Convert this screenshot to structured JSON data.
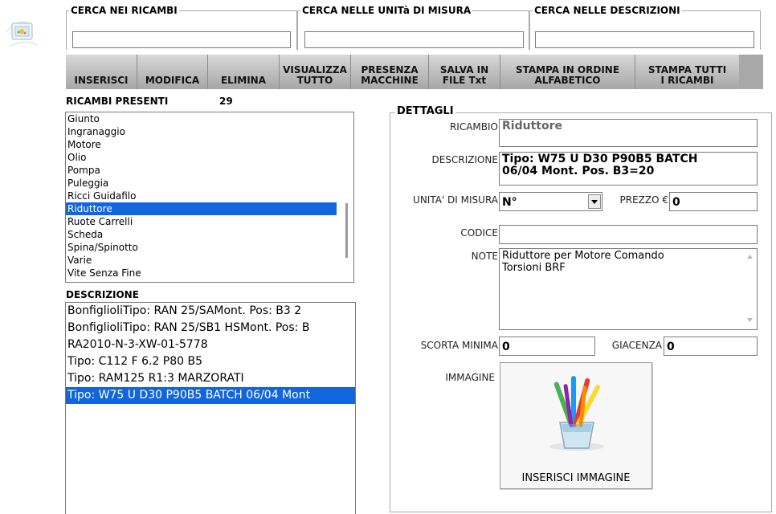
{
  "search": {
    "ricambi_legend": "CERCA NEI RICAMBI",
    "unita_legend": "CERCA NELLE UNITà DI MISURA",
    "descrizioni_legend": "CERCA NELLE DESCRIZIONI",
    "ricambi_value": "",
    "unita_value": "",
    "descrizioni_value": ""
  },
  "toolbar": {
    "buttons": [
      {
        "label": "INSERISCI"
      },
      {
        "label": "MODIFICA"
      },
      {
        "label": "ELIMINA"
      },
      {
        "line1": "VISUALIZZA",
        "line2": "TUTTO"
      },
      {
        "line1": "PRESENZA",
        "line2": "MACCHINE"
      },
      {
        "line1": "SALVA IN",
        "line2": "FILE Txt"
      },
      {
        "line1": "STAMPA IN ORDINE",
        "line2": "ALFABETICO"
      },
      {
        "line1": "STAMPA TUTTI",
        "line2": "I RICAMBI"
      }
    ]
  },
  "ricambi": {
    "heading": "RICAMBI PRESENTI",
    "count": "29",
    "items": [
      "Giunto",
      "Ingranaggio",
      "Motore",
      "Olio",
      "Pompa",
      "Puleggia",
      "Ricci Guidafilo",
      "Riduttore",
      "Ruote Carrelli",
      "Scheda",
      "Spina/Spinotto",
      "Varie",
      "Vite Senza Fine"
    ],
    "selected_index": 7
  },
  "descrizione_list": {
    "heading": "DESCRIZIONE",
    "items": [
      "BonfiglioliTipo: RAN 25/SAMont. Pos: B3 2",
      "BonfiglioliTipo: RAN 25/SB1 HSMont. Pos: B",
      "RA2010-N-3-XW-01-5778",
      "Tipo: C112 F 6.2 P80 B5",
      "Tipo: RAM125 R1:3 MARZORATI",
      "Tipo: W75 U D30 P90B5 BATCH 06/04 Mont"
    ],
    "selected_index": 5
  },
  "dettagli": {
    "legend": "DETTAGLI",
    "ricambio_label": "RICAMBIO",
    "ricambio_value": "Riduttore",
    "descrizione_label": "DESCRIZIONE",
    "descrizione_line1": "Tipo: W75 U D30 P90B5 BATCH",
    "descrizione_line2": "06/04 Mont. Pos. B3=20",
    "unita_label": "UNITA' DI MISURA",
    "unita_value": "N°",
    "prezzo_label": "PREZZO €",
    "prezzo_value": "0",
    "codice_label": "CODICE",
    "codice_value": "",
    "note_label": "NOTE",
    "note_line1": "Riduttore per Motore Comando",
    "note_line2": "Torsioni BRF",
    "scorta_label": "SCORTA MINIMA",
    "scorta_value": "0",
    "giacenza_label": "GIACENZA",
    "giacenza_value": "0",
    "immagine_label": "IMMAGINE",
    "inserisci_immagine": "INSERISCI IMMAGINE"
  },
  "colors": {
    "selection": "#1166dd",
    "toolbar": "#a8a8a8"
  },
  "icons": [
    "app-logo-icon",
    "dropdown-arrow-icon",
    "scroll-up-arrow-icon",
    "scroll-down-arrow-icon",
    "brushes-in-glass-icon"
  ]
}
